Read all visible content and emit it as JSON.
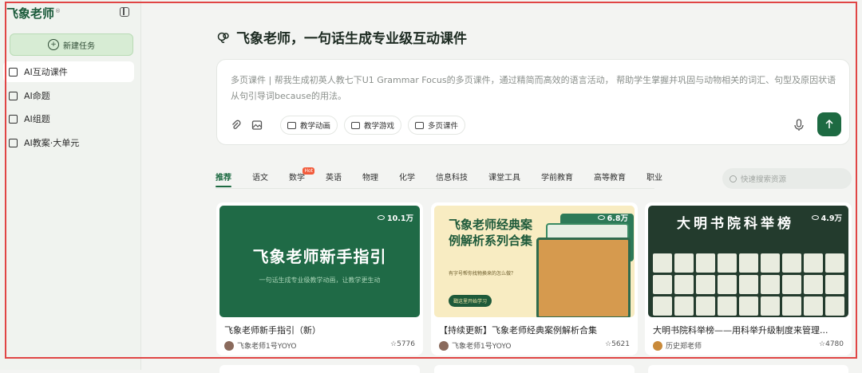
{
  "app": {
    "logo": "飞象老师",
    "logo_mark": "®"
  },
  "sidebar": {
    "new_task_label": "新建任务",
    "items": [
      {
        "label": "AI互动课件",
        "icon": "courseware-icon",
        "active": true
      },
      {
        "label": "AI命题",
        "icon": "question-icon",
        "active": false
      },
      {
        "label": "AI组题",
        "icon": "paper-icon",
        "active": false
      },
      {
        "label": "AI教案·大单元",
        "icon": "lesson-plan-icon",
        "active": false
      }
    ]
  },
  "main": {
    "headline": "飞象老师，一句话生成专业级互动课件",
    "prompt_text": "多页课件 | 帮我生成初英人教七下U1 Grammar Focus的多页课件，通过精简而高效的语言活动， 帮助学生掌握并巩固与动物相关的词汇、句型及原因状语从句引导词because的用法。",
    "chips": [
      "教学动画",
      "教学游戏",
      "多页课件"
    ],
    "accent_color": "#1d6a42"
  },
  "tabs": [
    {
      "label": "推荐",
      "active": true,
      "hot": false
    },
    {
      "label": "语文",
      "active": false,
      "hot": false
    },
    {
      "label": "数学",
      "active": false,
      "hot": true
    },
    {
      "label": "英语",
      "active": false,
      "hot": false
    },
    {
      "label": "物理",
      "active": false,
      "hot": false
    },
    {
      "label": "化学",
      "active": false,
      "hot": false
    },
    {
      "label": "信息科技",
      "active": false,
      "hot": false
    },
    {
      "label": "课堂工具",
      "active": false,
      "hot": false
    },
    {
      "label": "学前教育",
      "active": false,
      "hot": false
    },
    {
      "label": "高等教育",
      "active": false,
      "hot": false
    },
    {
      "label": "职业",
      "active": false,
      "hot": false
    }
  ],
  "hot_badge": "Hot",
  "search_placeholder": "快速搜索资源",
  "cards": [
    {
      "views": "10.1万",
      "thumb_title": "飞象老师新手指引",
      "thumb_sub": "一句话生成专业级教学动画，让教学更生动",
      "title": "飞象老师新手指引（新）",
      "author": "飞象老师1号YOYO",
      "stars": "5776"
    },
    {
      "views": "6.8万",
      "thumb_title": "飞象老师经典案例解析系列合集",
      "thumb_sub": "有字号帮你找物换来的怎么做？",
      "thumb_btn": "戳这里开始学习",
      "title": "【持续更新】飞象老师经典案例解析合集",
      "author": "飞象老师1号YOYO",
      "stars": "5621"
    },
    {
      "views": "4.9万",
      "thumb_title": "大明书院科举榜",
      "title": "大明书院科举榜——用科举升级制度来管理...",
      "author": "历史郑老师",
      "stars": "4780"
    }
  ]
}
